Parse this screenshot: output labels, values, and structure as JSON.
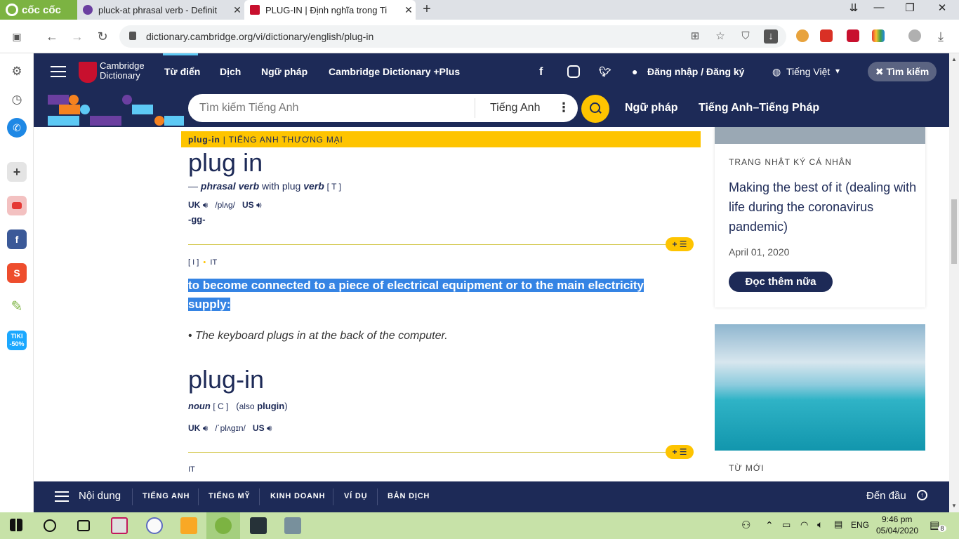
{
  "browser": {
    "brand": "cốc cốc",
    "tabs": [
      {
        "title": "pluck-at phrasal verb - Definit",
        "active": false
      },
      {
        "title": "PLUG-IN | Định nghĩa trong Ti",
        "active": true
      }
    ],
    "url": "dictionary.cambridge.org/vi/dictionary/english/plug-in"
  },
  "site": {
    "brand_line1": "Cambridge",
    "brand_line2": "Dictionary",
    "nav": [
      "Từ điển",
      "Dịch",
      "Ngữ pháp",
      "Cambridge Dictionary +Plus"
    ],
    "login": "Đăng nhập / Đăng ký",
    "language": "Tiếng Việt",
    "search_toggle": "Tìm kiếm",
    "search_placeholder": "Tìm kiếm Tiếng Anh",
    "search_lang": "Tiếng Anh",
    "sub_nav": [
      "Ngữ pháp",
      "Tiếng Anh–Tiếng Pháp"
    ]
  },
  "entry": {
    "ribbon_word": "plug-in",
    "ribbon_section": "TIẾNG ANH THƯƠNG MẠI",
    "headword1": "plug in",
    "pos1_dash": "— ",
    "pos1": "phrasal verb",
    "pos1_with": " with plug ",
    "pos1_verb": "verb",
    "pos1_gram": "[ T ]",
    "uk": "UK",
    "us": "US",
    "ipa1": "/plʌɡ/",
    "inflection": "-gg-",
    "gram_i": "[ I ]",
    "domain_it": "IT",
    "definition": "to become connected to a piece of electrical equipment or to the main electricity supply:",
    "example": "The keyboard plugs in at the back of the computer.",
    "headword2": "plug-in",
    "pos2": "noun",
    "pos2_gram": "[ C ]",
    "also_open": "(",
    "also": "also",
    "also_word": "plugin",
    "also_close": ")",
    "ipa2": "/ˈplʌɡɪn/",
    "domain_it2": "IT",
    "pill_label": "+ ☰"
  },
  "sidebar_card": {
    "tag": "TRANG NHẬT KÝ CÁ NHÂN",
    "title": "Making the best of it (dealing with life during the coronavirus pandemic)",
    "date": "April 01, 2020",
    "button": "Đọc thêm nữa",
    "new_words": "TỪ MỚI"
  },
  "bottom_nav": {
    "contents": "Nội dung",
    "items": [
      "TIẾNG ANH",
      "TIẾNG MỸ",
      "KINH DOANH",
      "VÍ DỤ",
      "BẢN DỊCH"
    ],
    "top": "Đến đầu"
  },
  "taskbar": {
    "lang": "ENG",
    "time": "9:46 pm",
    "date": "05/04/2020",
    "notifications": "8"
  },
  "colors": {
    "navy": "#1d2a57",
    "yellow": "#fec400",
    "selection": "#3584e4",
    "taskbar": "#c7e2a8"
  }
}
